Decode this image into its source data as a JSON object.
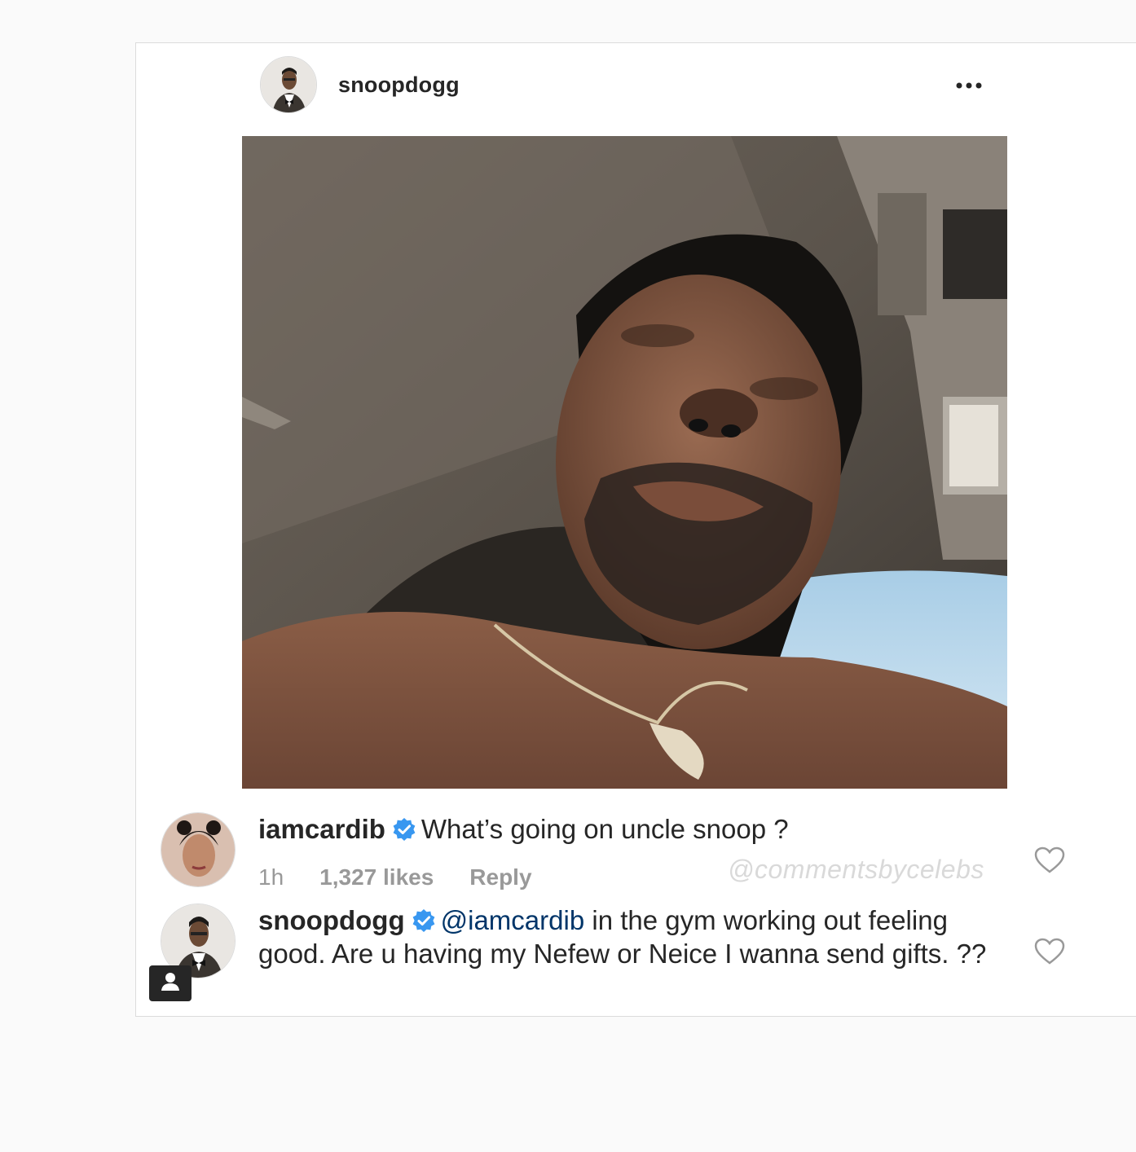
{
  "post": {
    "username": "snoopdogg",
    "more_icon": "more-horizontal-icon"
  },
  "comments": [
    {
      "username": "iamcardib",
      "verified_icon": "verified-badge-icon",
      "text": "What’s going on uncle snoop ?",
      "time": "1h",
      "likes": "1,327 likes",
      "reply": "Reply",
      "like_icon": "heart-outline-icon"
    },
    {
      "username": "snoopdogg",
      "verified_icon": "verified-badge-icon",
      "mention": "@iamcardib",
      "text": " in the gym working out feeling good. Are u having my Nefew or Neice I wanna send gifts. ??",
      "like_icon": "heart-outline-icon",
      "badge_icon": "person-icon"
    }
  ],
  "watermark": "@commentsbycelebs",
  "colors": {
    "verified_blue": "#3897f0",
    "mention": "#003569",
    "meta_gray": "#999999"
  }
}
